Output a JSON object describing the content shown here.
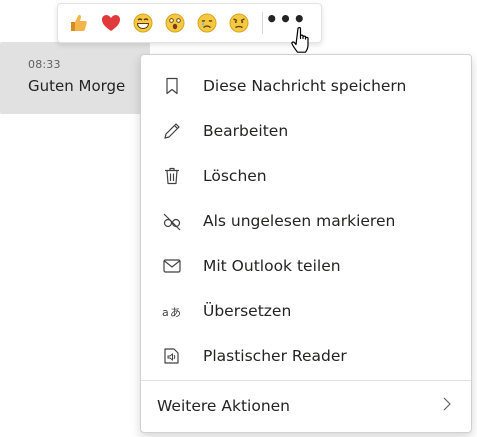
{
  "message": {
    "time": "08:33",
    "text": "Guten Morge"
  },
  "reactions": [
    {
      "icon": "thumbs-up-icon"
    },
    {
      "icon": "heart-icon"
    },
    {
      "icon": "laugh-icon"
    },
    {
      "icon": "surprised-icon"
    },
    {
      "icon": "sad-icon"
    },
    {
      "icon": "angry-icon"
    }
  ],
  "more_options_label": "•••",
  "menu": {
    "items": [
      {
        "label": "Diese Nachricht speichern",
        "icon": "bookmark-icon"
      },
      {
        "label": "Bearbeiten",
        "icon": "pencil-icon"
      },
      {
        "label": "Löschen",
        "icon": "trash-icon"
      },
      {
        "label": "Als ungelesen markieren",
        "icon": "unread-glasses-icon"
      },
      {
        "label": "Mit Outlook teilen",
        "icon": "mail-icon"
      },
      {
        "label": "Übersetzen",
        "icon": "translate-icon"
      },
      {
        "label": "Plastischer Reader",
        "icon": "immersive-reader-icon"
      }
    ],
    "more_actions_label": "Weitere Aktionen"
  },
  "colors": {
    "bubble": "#e1e1e1",
    "text": "#252423",
    "reaction_yellow": "#f2c13d",
    "heart_red": "#e03a3a",
    "thumb_orange": "#f0a830"
  }
}
